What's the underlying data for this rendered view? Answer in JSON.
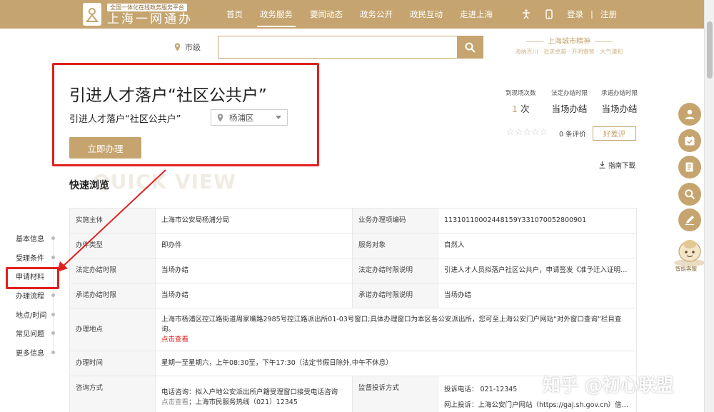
{
  "header": {
    "logo_sub": "全国一体化在线政务服务平台",
    "logo_main": "上海一网通办",
    "nav": [
      "首页",
      "政务服务",
      "要闻动态",
      "政务公开",
      "政民互动",
      "走进上海"
    ],
    "active_nav": "政务服务",
    "login": "登录",
    "separator": "|",
    "register": "注册",
    "accent_color": "#c5a46f"
  },
  "search": {
    "region": "市级",
    "placeholder": "",
    "value": ""
  },
  "spirit": {
    "title": "上海城市精神",
    "sub": "海纳百川 · 追求卓越 · 开明睿智 · 大气谦和"
  },
  "service": {
    "title": "引进人才落户“社区公共户”",
    "subtitle": "引进人才落户“社区公共户”",
    "district": "杨浦区",
    "apply_label": "立即办理"
  },
  "stats": {
    "visits_label": "到现场次数",
    "visits_num": "1",
    "visits_unit": "次",
    "legal_label": "法定办结时限",
    "legal_value": "当场办结",
    "promise_label": "承诺办结时限",
    "promise_value": "当场办结",
    "rating_stars": 0,
    "rating_max": 5,
    "eval_count": "0 条评价",
    "good_label": "好差评",
    "guide_label": "指南下载"
  },
  "quick_view": {
    "title": "快速浏览",
    "bg_text": "QUICK VIEW"
  },
  "side_nav": {
    "items": [
      "基本信息",
      "受理条件",
      "申请材料",
      "办理流程",
      "地点/时间",
      "常见问题",
      "更多信息"
    ],
    "active": "申请材料"
  },
  "table": {
    "r1": {
      "l1": "实施主体",
      "v1": "上海市公安局杨浦分局",
      "l2": "业务办理项编码",
      "v2": "11310110002448159Y331070052800901"
    },
    "r2": {
      "l1": "办件类型",
      "v1": "即办件",
      "l2": "服务对象",
      "v2": "自然人"
    },
    "r3": {
      "l1": "法定办结时限",
      "v1": "当场办结",
      "l2": "法定办结时限说明",
      "v2": "引进人才人员拟落户社区公共户，申请签发《准予迁入证明》..."
    },
    "r4": {
      "l1": "承诺办结时限",
      "v1": "当场办结",
      "l2": "承诺办结时限说明",
      "v2": "当场办结"
    },
    "r5": {
      "l1": "办理地点",
      "v1": "上海市杨浦区控江路街道周家嘴路2985号控江路派出所01-03号窗口;具体办理窗口为本区各公安派出所，您可至上海公安门户网站“对外窗口查询”栏目查询。",
      "link": "点击查看"
    },
    "r6": {
      "l1": "办理时间",
      "v1": "星期一至星期六，上午08:30至，下午17:30（法定节假日除外,中午不休息）"
    },
    "r7": {
      "l1": "咨询方式",
      "v1a": "电话咨询：拟入户地公安派出所户籍受理窗口接受电话咨询",
      "v1link": "点击查看",
      "v1b": "；上海市民服务热线（021）12345",
      "l2": "监督投诉方式",
      "v2a": "投诉电话：  021-12345",
      "v2b": "网上投诉：上海公安门户网站（https://gaj.sh.gov.cn）信访信"
    }
  },
  "floating": {
    "icons": [
      "user-icon",
      "calendar-check-icon",
      "document-edit-icon",
      "search-icon",
      "pen-icon"
    ],
    "robot_label": "智能客服"
  },
  "watermark": "知乎 @初心联盟"
}
